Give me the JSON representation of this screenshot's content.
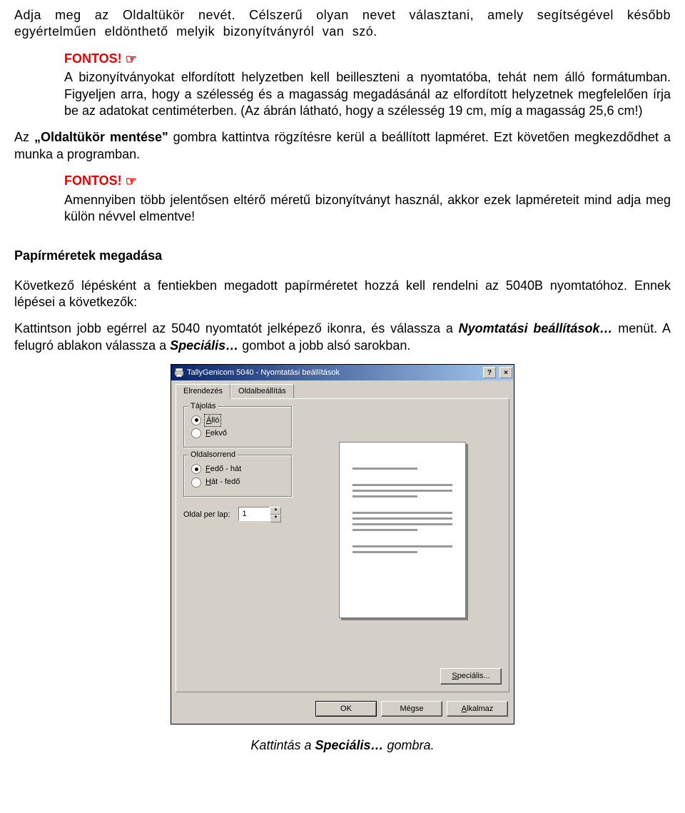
{
  "text": {
    "p1": "Adja meg az Oldaltükör nevét. Célszerű olyan nevet választani, amely segítségével később egyértelműen eldönthető melyik bizonyítványról van szó.",
    "fontos1_label": "FONTOS!",
    "fontos1_body": "A bizonyítványokat elfordított helyzetben kell beilleszteni a nyomtatóba, tehát nem álló formátumban. Figyeljen arra, hogy a szélesség és a magasság megadásánál az elfordított helyzetnek megfelelően írja be az adatokat centiméterben. (Az ábrán látható, hogy a szélesség 19 cm, míg a magasság 25,6 cm!)",
    "p2_a": "Az ",
    "p2_b": "„Oldaltükör mentése\"",
    "p2_c": " gombra kattintva rögzítésre kerül a beállított lapméret. Ezt követően megkezdődhet a munka a programban.",
    "fontos2_label": "FONTOS!",
    "fontos2_body": "Amennyiben több jelentősen eltérő méretű bizonyítványt használ, akkor ezek lapméreteit mind adja meg külön névvel elmentve!",
    "h1": "Papírméretek megadása",
    "p3": "Következő lépésként a fentiekben megadott papírméretet hozzá kell rendelni az 5040B nyomtatóhoz. Ennek lépései a következők:",
    "p4_a": "Kattintson jobb egérrel az 5040 nyomtatót jelképező ikonra, és válassza a ",
    "p4_b": "Nyomtatási beállítások…",
    "p4_c": " menüt. A felugró ablakon válassza a ",
    "p4_d": "Speciális…",
    "p4_e": " gombot a jobb alsó sarokban.",
    "caption_a": "Kattintás a ",
    "caption_b": "Speciális…",
    "caption_c": " gombra."
  },
  "dialog": {
    "title": "TallyGenicom 5040 - Nyomtatási beállítások",
    "help_btn": "?",
    "close_btn": "×",
    "tabs": {
      "active": "Elrendezés",
      "inactive": "Oldalbeállítás"
    },
    "group_orientation": {
      "title": "Tájolás",
      "option1": "Álló",
      "option2": "Fekvő"
    },
    "group_order": {
      "title": "Oldalsorrend",
      "option1": "Fedő - hát",
      "option2": "Hát - fedő"
    },
    "pages_per_sheet": {
      "label": "Oldal per lap:",
      "value": "1"
    },
    "special_btn": "Speciális...",
    "footer": {
      "ok": "OK",
      "cancel": "Mégse",
      "apply": "Alkalmaz"
    }
  }
}
